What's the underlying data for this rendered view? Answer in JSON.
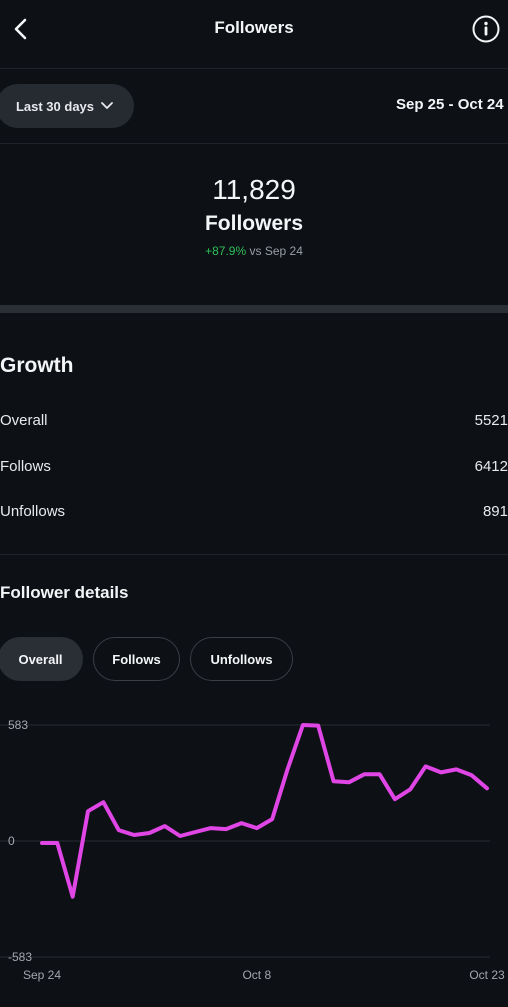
{
  "header": {
    "title": "Followers",
    "back_icon": "chevron-left-icon",
    "info_icon": "info-circle-icon"
  },
  "range": {
    "label": "Last 30 days",
    "dates": "Sep 25 - Oct 24"
  },
  "summary": {
    "count": "11,829",
    "label": "Followers",
    "change": "+87.9%",
    "change_suffix": "vs Sep 24"
  },
  "growth": {
    "title": "Growth",
    "rows": [
      {
        "label": "Overall",
        "value": "5521"
      },
      {
        "label": "Follows",
        "value": "6412"
      },
      {
        "label": "Unfollows",
        "value": "891"
      }
    ]
  },
  "details": {
    "title": "Follower details",
    "tabs": [
      {
        "label": "Overall",
        "selected": true
      },
      {
        "label": "Follows",
        "selected": false
      },
      {
        "label": "Unfollows",
        "selected": false
      }
    ]
  },
  "colors": {
    "line": "#e046e6",
    "positive": "#2fbf5a",
    "background": "#0d1015"
  },
  "chart_data": {
    "type": "line",
    "x": [
      "Sep 24",
      "Sep 25",
      "Sep 26",
      "Sep 27",
      "Sep 28",
      "Sep 29",
      "Sep 30",
      "Oct 1",
      "Oct 2",
      "Oct 3",
      "Oct 4",
      "Oct 5",
      "Oct 6",
      "Oct 7",
      "Oct 8",
      "Oct 9",
      "Oct 10",
      "Oct 11",
      "Oct 12",
      "Oct 13",
      "Oct 14",
      "Oct 15",
      "Oct 16",
      "Oct 17",
      "Oct 18",
      "Oct 19",
      "Oct 20",
      "Oct 21",
      "Oct 22",
      "Oct 23"
    ],
    "series": [
      {
        "values": [
          -10,
          -10,
          -280,
          150,
          195,
          55,
          30,
          40,
          75,
          25,
          45,
          65,
          60,
          90,
          65,
          110,
          360,
          583,
          580,
          300,
          295,
          335,
          335,
          210,
          260,
          375,
          345,
          360,
          330,
          265
        ]
      }
    ],
    "xticks": [
      "Sep 24",
      "Oct 8",
      "Oct 23"
    ],
    "yticks": [
      "583",
      "0",
      "-583"
    ],
    "ylim": [
      -583,
      583
    ],
    "grid": true
  }
}
